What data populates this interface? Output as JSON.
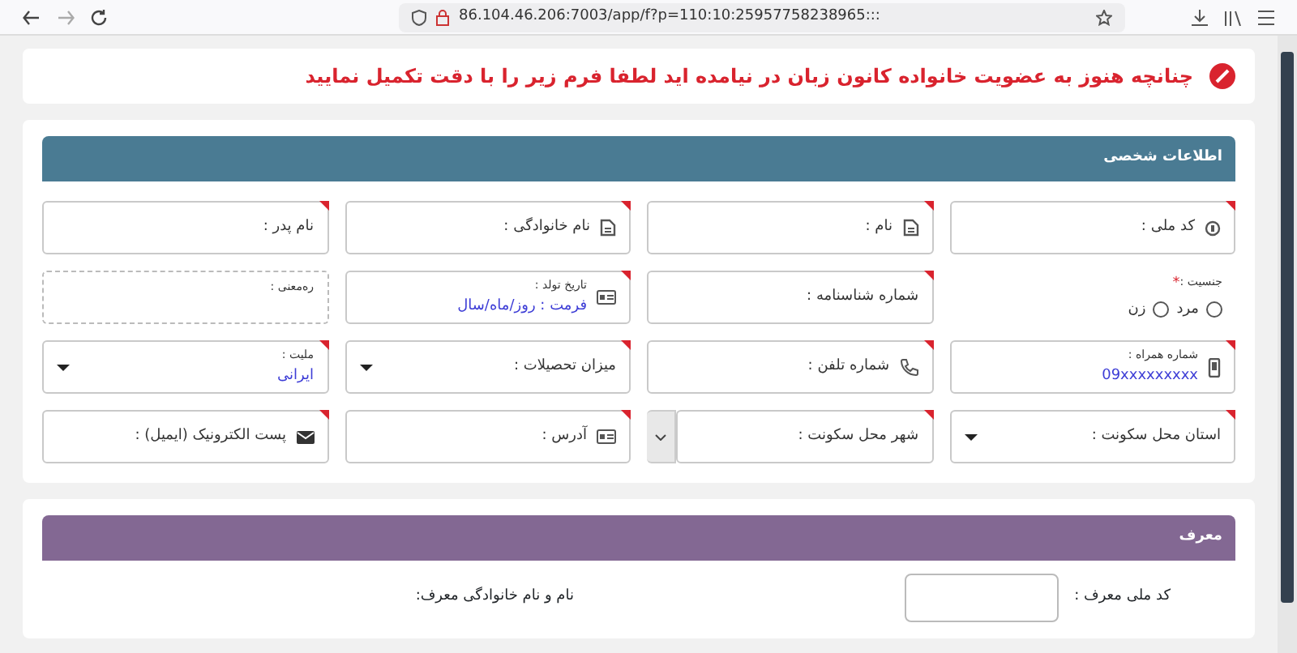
{
  "browser": {
    "url": "86.104.46.206:7003/app/f?p=110:10:25957758238965:::"
  },
  "alert": {
    "text": "چنانچه هنوز به عضویت خانواده کانون زبان در نیامده اید لطفا فرم زیر را با دقت تکمیل نمایید"
  },
  "sections": [
    {
      "title": "اطلاعات شخصی",
      "color": "#4a7b93",
      "fields": [
        {
          "kind": "text",
          "label": "کد ملی :",
          "required": true
        },
        {
          "kind": "text",
          "label": "نام :",
          "required": true
        },
        {
          "kind": "text",
          "label": "نام خانوادگی :",
          "required": true
        },
        {
          "kind": "text",
          "label": "نام پدر :",
          "required": true
        },
        {
          "kind": "radio",
          "label": "جنسیت :",
          "required_mark": "*",
          "options": [
            {
              "label": "مرد",
              "selected": false
            },
            {
              "label": "زن",
              "selected": false
            }
          ]
        },
        {
          "kind": "text",
          "label": "شماره شناسنامه :",
          "required": true
        },
        {
          "kind": "text",
          "label": "تاریخ تولد :",
          "value": "فرمت : روز/ماه/سال",
          "required": true
        },
        {
          "kind": "readonly",
          "label": "ره‌معنی :",
          "required": false
        },
        {
          "kind": "text",
          "label": "شماره همراه :",
          "value": "09xxxxxxxxx",
          "required": true
        },
        {
          "kind": "text",
          "label": "شماره تلفن :",
          "required": true
        },
        {
          "kind": "select",
          "label": "میزان تحصیلات :",
          "required": true
        },
        {
          "kind": "select",
          "label": "ملیت :",
          "value": "ایرانی",
          "required": true
        },
        {
          "kind": "select",
          "label": "استان محل سکونت :",
          "required": true
        },
        {
          "kind": "combo",
          "label": "شهر محل سکونت :",
          "required": true
        },
        {
          "kind": "text",
          "label": "آدرس :",
          "required": true
        },
        {
          "kind": "text",
          "label": "پست الکترونیک (ایمیل) :",
          "required": true
        }
      ]
    },
    {
      "title": "معرف",
      "color": "#836893",
      "fields": [
        {
          "kind": "boxed",
          "label": "کد ملی معرف :",
          "required": false
        },
        {
          "kind": "label",
          "label": "نام و نام خانوادگی معرف:",
          "required": false
        }
      ]
    }
  ]
}
